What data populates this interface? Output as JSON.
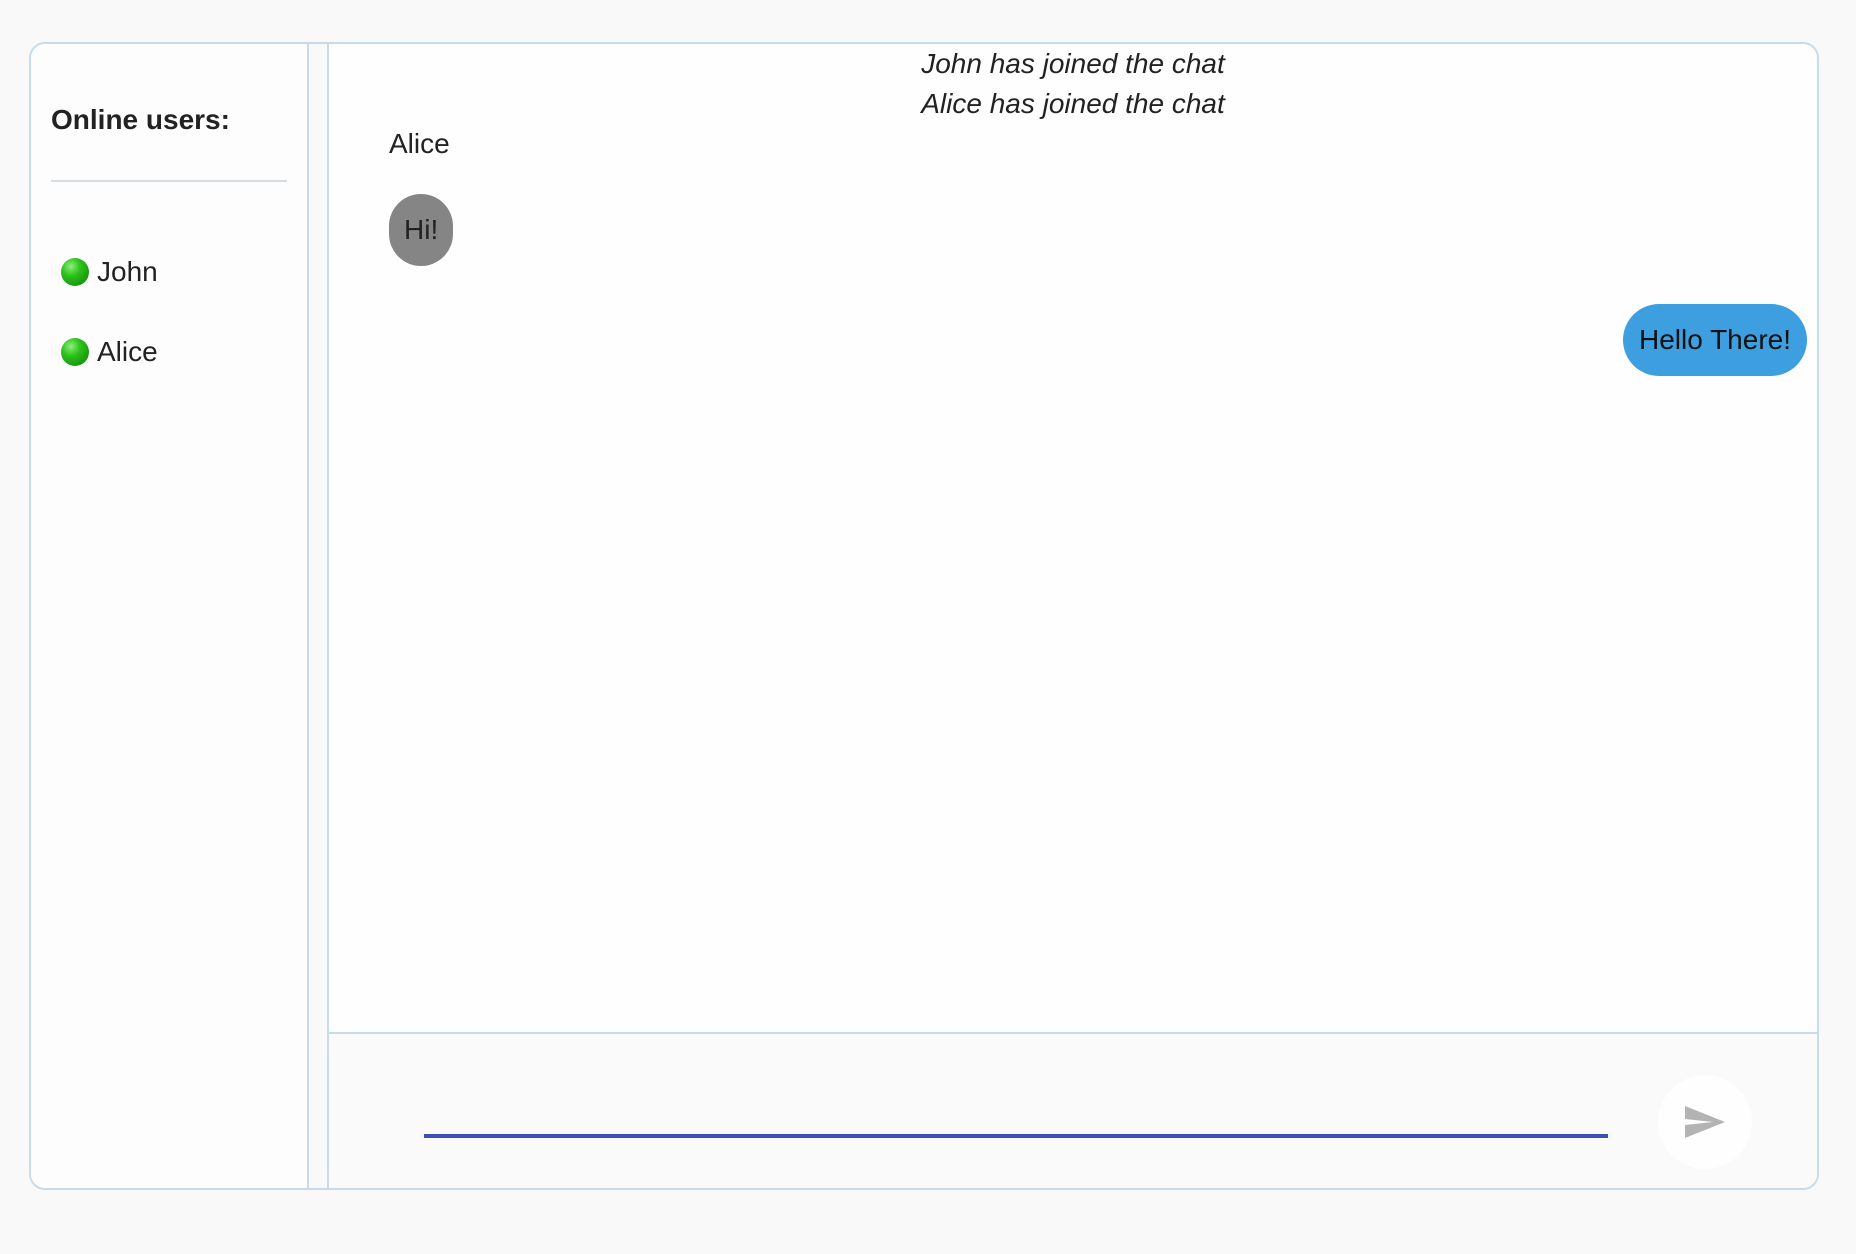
{
  "sidebar": {
    "title": "Online users:",
    "users": [
      {
        "name": "John",
        "status": "online"
      },
      {
        "name": "Alice",
        "status": "online"
      }
    ]
  },
  "chat": {
    "system_messages": [
      "John has joined the chat",
      "Alice has joined the chat"
    ],
    "received": {
      "sender": "Alice",
      "text": "Hi!"
    },
    "sent": {
      "text": "Hello There!"
    }
  },
  "composer": {
    "input_value": "",
    "send_icon": "send-icon"
  },
  "colors": {
    "border": "#c7dce8",
    "received_bubble": "#858585",
    "sent_bubble": "#3d9ee0",
    "input_underline": "#3f51b5",
    "online_indicator": "#2fc21c",
    "send_icon": "#b3b3b3"
  }
}
